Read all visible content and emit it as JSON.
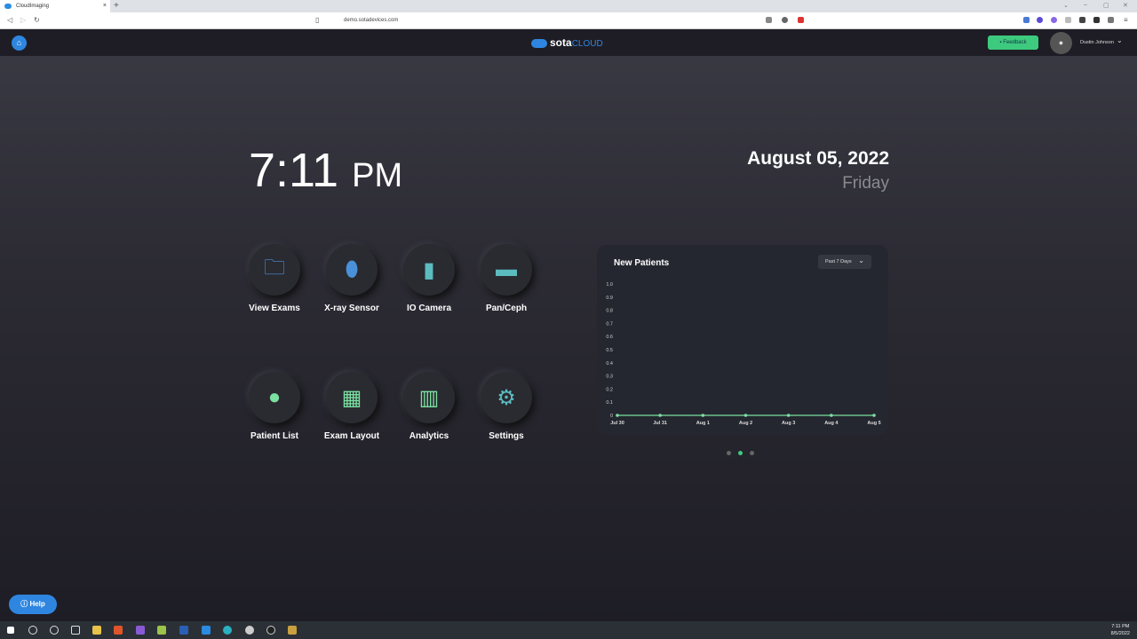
{
  "browser": {
    "tab_title": "CloudImaging",
    "url": "demo.sotadevices.com"
  },
  "header": {
    "logo_main": "sota",
    "logo_sub": "CLOUD",
    "feedback_label": "Feedback",
    "user_name": "Dustin Johnson"
  },
  "clock": {
    "time": "7:11",
    "ampm": "PM",
    "date": "August 05, 2022",
    "day": "Friday"
  },
  "tiles": [
    {
      "label": "View Exams",
      "icon": "folder-search-icon",
      "color": "#4a90d9"
    },
    {
      "label": "X-ray Sensor",
      "icon": "xray-sensor-icon",
      "color": "#4a90d9"
    },
    {
      "label": "IO Camera",
      "icon": "intraoral-camera-icon",
      "color": "#5bbcc0"
    },
    {
      "label": "Pan/Ceph",
      "icon": "panoramic-icon",
      "color": "#5bbcc0"
    },
    {
      "label": "Patient List",
      "icon": "user-icon",
      "color": "#7be0a0"
    },
    {
      "label": "Exam Layout",
      "icon": "layout-icon",
      "color": "#7be0a0"
    },
    {
      "label": "Analytics",
      "icon": "bar-chart-icon",
      "color": "#7be0a0"
    },
    {
      "label": "Settings",
      "icon": "gear-icon",
      "color": "#5bbcc0"
    }
  ],
  "chart_card": {
    "range_label": "Past 7 Days"
  },
  "chart_data": {
    "type": "line",
    "title": "New Patients",
    "categories": [
      "Jul 30",
      "Jul 31",
      "Aug 1",
      "Aug 2",
      "Aug 3",
      "Aug 4",
      "Aug 5"
    ],
    "values": [
      0,
      0,
      0,
      0,
      0,
      0,
      0
    ],
    "ylim": [
      0,
      1
    ],
    "yticks": [
      "0",
      "0.1",
      "0.2",
      "0.3",
      "0.4",
      "0.5",
      "0.6",
      "0.7",
      "0.8",
      "0.9",
      "1.0"
    ],
    "color": "#7be0a0",
    "xlabel": "",
    "ylabel": ""
  },
  "help_label": "Help",
  "taskbar": {
    "time": "7:11 PM",
    "date": "8/5/2022"
  }
}
